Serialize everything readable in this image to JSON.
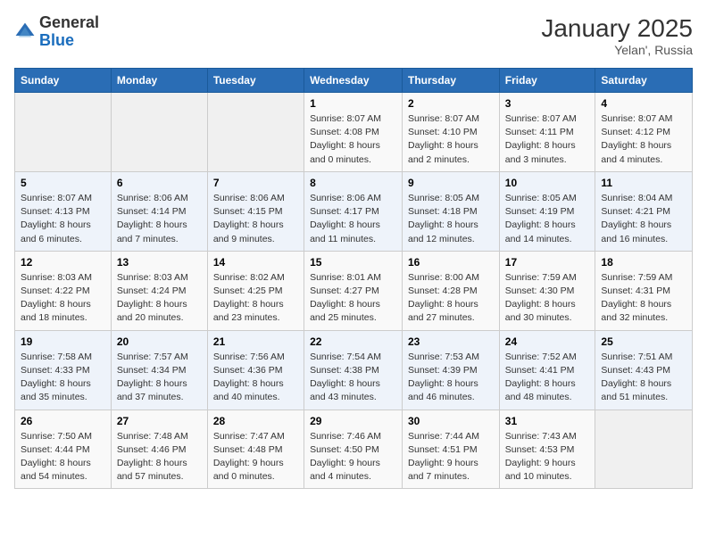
{
  "logo": {
    "general": "General",
    "blue": "Blue"
  },
  "title": {
    "month_year": "January 2025",
    "location": "Yelan', Russia"
  },
  "calendar": {
    "headers": [
      "Sunday",
      "Monday",
      "Tuesday",
      "Wednesday",
      "Thursday",
      "Friday",
      "Saturday"
    ],
    "weeks": [
      [
        {
          "day": "",
          "info": ""
        },
        {
          "day": "",
          "info": ""
        },
        {
          "day": "",
          "info": ""
        },
        {
          "day": "1",
          "info": "Sunrise: 8:07 AM\nSunset: 4:08 PM\nDaylight: 8 hours\nand 0 minutes."
        },
        {
          "day": "2",
          "info": "Sunrise: 8:07 AM\nSunset: 4:10 PM\nDaylight: 8 hours\nand 2 minutes."
        },
        {
          "day": "3",
          "info": "Sunrise: 8:07 AM\nSunset: 4:11 PM\nDaylight: 8 hours\nand 3 minutes."
        },
        {
          "day": "4",
          "info": "Sunrise: 8:07 AM\nSunset: 4:12 PM\nDaylight: 8 hours\nand 4 minutes."
        }
      ],
      [
        {
          "day": "5",
          "info": "Sunrise: 8:07 AM\nSunset: 4:13 PM\nDaylight: 8 hours\nand 6 minutes."
        },
        {
          "day": "6",
          "info": "Sunrise: 8:06 AM\nSunset: 4:14 PM\nDaylight: 8 hours\nand 7 minutes."
        },
        {
          "day": "7",
          "info": "Sunrise: 8:06 AM\nSunset: 4:15 PM\nDaylight: 8 hours\nand 9 minutes."
        },
        {
          "day": "8",
          "info": "Sunrise: 8:06 AM\nSunset: 4:17 PM\nDaylight: 8 hours\nand 11 minutes."
        },
        {
          "day": "9",
          "info": "Sunrise: 8:05 AM\nSunset: 4:18 PM\nDaylight: 8 hours\nand 12 minutes."
        },
        {
          "day": "10",
          "info": "Sunrise: 8:05 AM\nSunset: 4:19 PM\nDaylight: 8 hours\nand 14 minutes."
        },
        {
          "day": "11",
          "info": "Sunrise: 8:04 AM\nSunset: 4:21 PM\nDaylight: 8 hours\nand 16 minutes."
        }
      ],
      [
        {
          "day": "12",
          "info": "Sunrise: 8:03 AM\nSunset: 4:22 PM\nDaylight: 8 hours\nand 18 minutes."
        },
        {
          "day": "13",
          "info": "Sunrise: 8:03 AM\nSunset: 4:24 PM\nDaylight: 8 hours\nand 20 minutes."
        },
        {
          "day": "14",
          "info": "Sunrise: 8:02 AM\nSunset: 4:25 PM\nDaylight: 8 hours\nand 23 minutes."
        },
        {
          "day": "15",
          "info": "Sunrise: 8:01 AM\nSunset: 4:27 PM\nDaylight: 8 hours\nand 25 minutes."
        },
        {
          "day": "16",
          "info": "Sunrise: 8:00 AM\nSunset: 4:28 PM\nDaylight: 8 hours\nand 27 minutes."
        },
        {
          "day": "17",
          "info": "Sunrise: 7:59 AM\nSunset: 4:30 PM\nDaylight: 8 hours\nand 30 minutes."
        },
        {
          "day": "18",
          "info": "Sunrise: 7:59 AM\nSunset: 4:31 PM\nDaylight: 8 hours\nand 32 minutes."
        }
      ],
      [
        {
          "day": "19",
          "info": "Sunrise: 7:58 AM\nSunset: 4:33 PM\nDaylight: 8 hours\nand 35 minutes."
        },
        {
          "day": "20",
          "info": "Sunrise: 7:57 AM\nSunset: 4:34 PM\nDaylight: 8 hours\nand 37 minutes."
        },
        {
          "day": "21",
          "info": "Sunrise: 7:56 AM\nSunset: 4:36 PM\nDaylight: 8 hours\nand 40 minutes."
        },
        {
          "day": "22",
          "info": "Sunrise: 7:54 AM\nSunset: 4:38 PM\nDaylight: 8 hours\nand 43 minutes."
        },
        {
          "day": "23",
          "info": "Sunrise: 7:53 AM\nSunset: 4:39 PM\nDaylight: 8 hours\nand 46 minutes."
        },
        {
          "day": "24",
          "info": "Sunrise: 7:52 AM\nSunset: 4:41 PM\nDaylight: 8 hours\nand 48 minutes."
        },
        {
          "day": "25",
          "info": "Sunrise: 7:51 AM\nSunset: 4:43 PM\nDaylight: 8 hours\nand 51 minutes."
        }
      ],
      [
        {
          "day": "26",
          "info": "Sunrise: 7:50 AM\nSunset: 4:44 PM\nDaylight: 8 hours\nand 54 minutes."
        },
        {
          "day": "27",
          "info": "Sunrise: 7:48 AM\nSunset: 4:46 PM\nDaylight: 8 hours\nand 57 minutes."
        },
        {
          "day": "28",
          "info": "Sunrise: 7:47 AM\nSunset: 4:48 PM\nDaylight: 9 hours\nand 0 minutes."
        },
        {
          "day": "29",
          "info": "Sunrise: 7:46 AM\nSunset: 4:50 PM\nDaylight: 9 hours\nand 4 minutes."
        },
        {
          "day": "30",
          "info": "Sunrise: 7:44 AM\nSunset: 4:51 PM\nDaylight: 9 hours\nand 7 minutes."
        },
        {
          "day": "31",
          "info": "Sunrise: 7:43 AM\nSunset: 4:53 PM\nDaylight: 9 hours\nand 10 minutes."
        },
        {
          "day": "",
          "info": ""
        }
      ]
    ]
  }
}
